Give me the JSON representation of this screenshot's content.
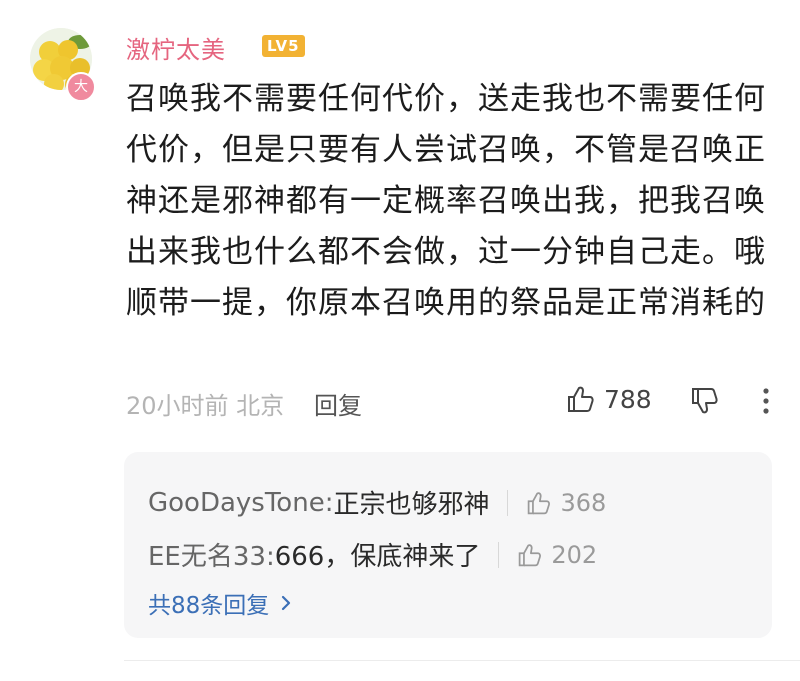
{
  "comment": {
    "username": "激柠太美",
    "level": "LV5",
    "avatar_badge": "大",
    "text": "召唤我不需要任何代价，送走我也不需要任何代价，但是只要有人尝试召唤，不管是召唤正神还是邪神都有一定概率召唤出我，把我召唤出来我也什么都不会做，过一分钟自己走。哦顺带一提，你原本召唤用的祭品是正常消耗的",
    "meta": "20小时前 北京",
    "reply_label": "回复",
    "like_count": "788"
  },
  "replies": [
    {
      "author": "GooDaysTone:",
      "text": " 正宗也够邪神",
      "likes": "368"
    },
    {
      "author": "EE无名33:",
      "text": " 666，保底神来了",
      "likes": "202"
    }
  ],
  "total_replies_label": "共88条回复",
  "colors": {
    "username": "#e5657f",
    "level_badge": "#f2b233",
    "link": "#3b6fb6"
  }
}
